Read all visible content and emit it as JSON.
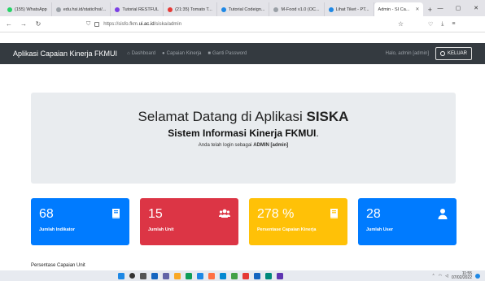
{
  "browser": {
    "tabs": [
      {
        "label": "(155) WhatsApp",
        "color": "#25d366"
      },
      {
        "label": "edu.hsi.id/static/hsi/...",
        "color": "#9aa0a6"
      },
      {
        "label": "Tutorial RESTFUL",
        "color": "#7b3fe4"
      },
      {
        "label": "(21:35) Tomato T...",
        "color": "#e53935"
      },
      {
        "label": "Tutorial Codeign...",
        "color": "#1e88e5"
      },
      {
        "label": "M-Food v1.0 (OC...",
        "color": "#9aa0a6"
      },
      {
        "label": "Lihat Tiket - PT...",
        "color": "#1e88e5"
      },
      {
        "label": "Admin - SI Ca...",
        "color": "#ffffff"
      }
    ],
    "active_tab": "Admin - SI Ca...",
    "url_prefix": "https://sisfo.fkm.",
    "url_domain": "ui.ac.id",
    "url_path": "/siska/admin"
  },
  "navbar": {
    "brand": "Aplikasi Capaian Kinerja FKMUI",
    "links": [
      {
        "label": "Dashboard",
        "icon": "home-icon"
      },
      {
        "label": "Capaian Kinerja",
        "icon": "user-icon"
      },
      {
        "label": "Ganti Password",
        "icon": "lock-icon"
      }
    ],
    "user_text": "Halo, admin [admin]",
    "logout_label": "KELUAR"
  },
  "jumbotron": {
    "title_prefix": "Selamat Datang di Aplikasi ",
    "title_bold": "SISKA",
    "subtitle": "Sistem Informasi Kinerja FKMUI",
    "subtitle_dot": ".",
    "login_prefix": "Anda telah login sebagai ",
    "login_user": "ADMIN [admin]"
  },
  "cards": [
    {
      "value": "68",
      "label": "Jumlah Indikator",
      "icon": "book-icon",
      "color": "#007bff"
    },
    {
      "value": "15",
      "label": "Jumlah Unit",
      "icon": "users-icon",
      "color": "#dc3545"
    },
    {
      "value": "278 %",
      "label": "Persentase Capaian Kinerja",
      "icon": "book-icon",
      "color": "#ffc107"
    },
    {
      "value": "28",
      "label": "Jumlah User",
      "icon": "user-icon",
      "color": "#007bff"
    }
  ],
  "section_title_cut": "Persentase Capaian Unit",
  "taskbar": {
    "time": "11:55",
    "date": "07/02/2022"
  }
}
